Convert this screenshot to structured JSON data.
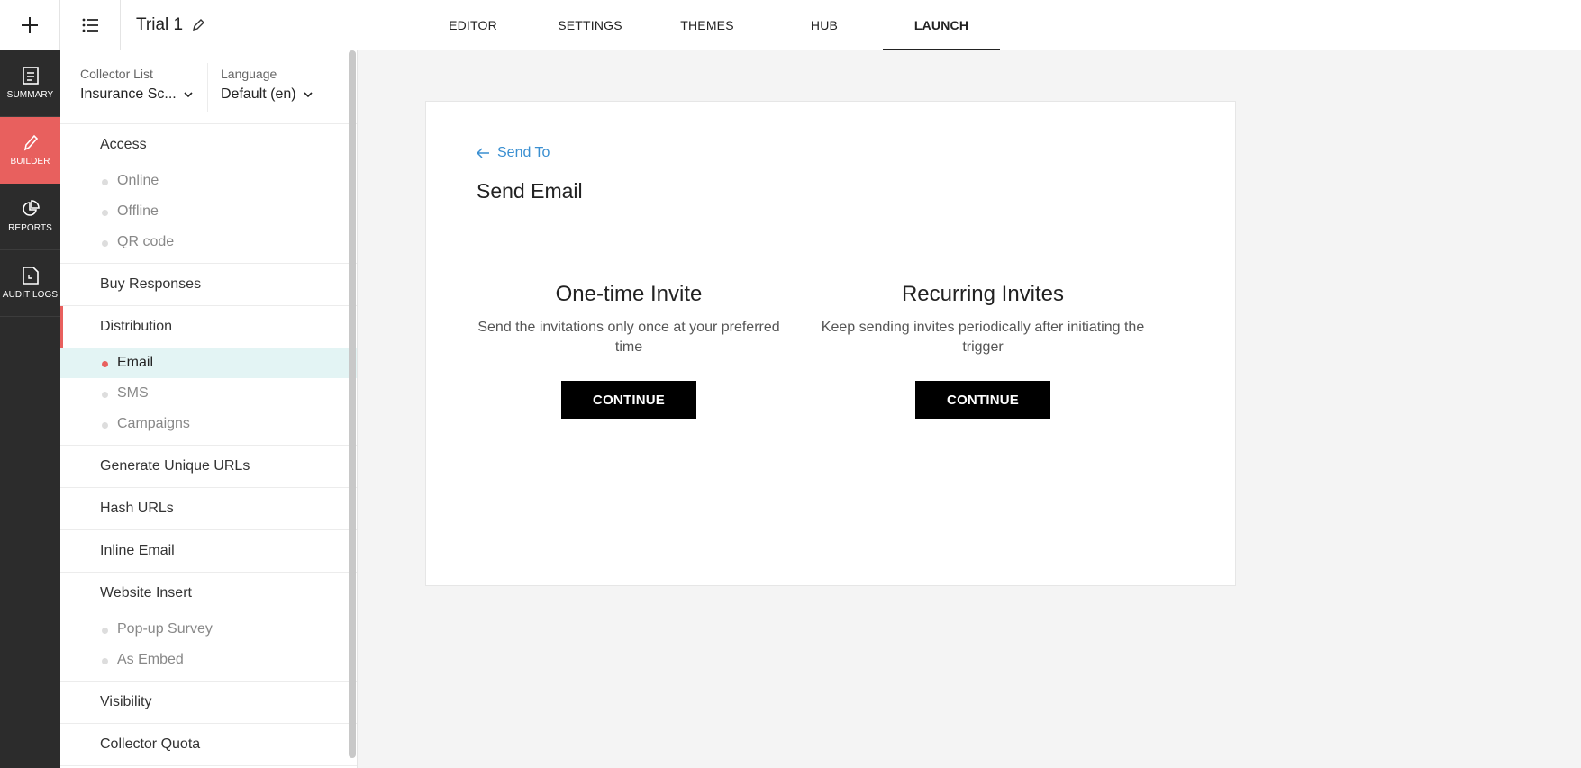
{
  "header": {
    "survey_title": "Trial 1",
    "tabs": [
      {
        "label": "EDITOR"
      },
      {
        "label": "SETTINGS"
      },
      {
        "label": "THEMES"
      },
      {
        "label": "HUB"
      },
      {
        "label": "LAUNCH"
      }
    ],
    "active_tab": "LAUNCH"
  },
  "rail": {
    "items": [
      {
        "label": "SUMMARY",
        "icon": "summary-icon"
      },
      {
        "label": "BUILDER",
        "icon": "pencil-icon"
      },
      {
        "label": "REPORTS",
        "icon": "pie-chart-icon"
      },
      {
        "label": "AUDIT LOGS",
        "icon": "audit-log-icon"
      }
    ],
    "active": "BUILDER"
  },
  "sidebar": {
    "collector_label": "Collector List",
    "collector_value": "Insurance Sc...",
    "language_label": "Language",
    "language_value": "Default (en)",
    "sections": {
      "access": {
        "title": "Access",
        "items": [
          "Online",
          "Offline",
          "QR code"
        ]
      },
      "buy_responses": {
        "title": "Buy Responses"
      },
      "distribution": {
        "title": "Distribution",
        "items": [
          "Email",
          "SMS",
          "Campaigns"
        ]
      },
      "unique_urls": {
        "title": "Generate Unique URLs"
      },
      "hash_urls": {
        "title": "Hash URLs"
      },
      "inline_email": {
        "title": "Inline Email"
      },
      "website_insert": {
        "title": "Website Insert",
        "items": [
          "Pop-up Survey",
          "As Embed"
        ]
      },
      "visibility": {
        "title": "Visibility"
      },
      "collector_quota": {
        "title": "Collector Quota"
      }
    }
  },
  "main": {
    "back_label": "Send To",
    "title": "Send Email",
    "options": [
      {
        "title": "One-time Invite",
        "description": "Send the invitations only once at your preferred time",
        "button": "CONTINUE"
      },
      {
        "title": "Recurring Invites",
        "description": "Keep sending invites periodically after initiating the trigger",
        "button": "CONTINUE"
      }
    ]
  },
  "colors": {
    "accent": "#e8605e",
    "link": "#3a8fd1",
    "rail_bg": "#2c2c2c",
    "active_row_bg": "#e3f4f4"
  }
}
